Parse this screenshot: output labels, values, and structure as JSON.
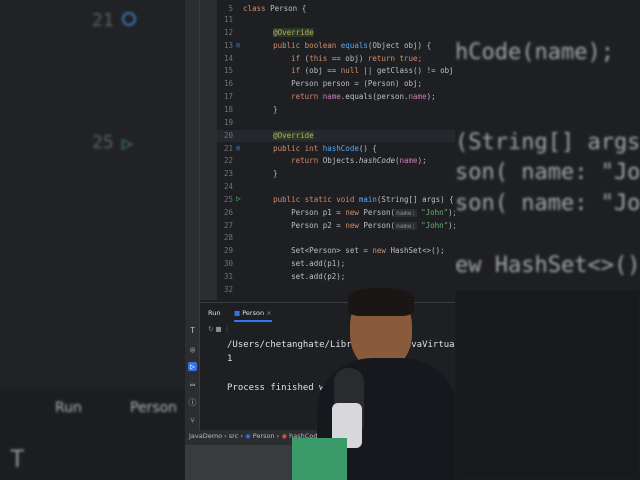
{
  "left_bg": {
    "line_numbers": [
      "21",
      "25"
    ],
    "run_label": "Run",
    "tab_label": "Person"
  },
  "right_bg": {
    "lines": [
      "hCode(name);",
      "(String[] args) {",
      "son( name: \"John\");",
      "son( name: \"John\");",
      "ew HashSet<>();"
    ]
  },
  "editor": {
    "sticky_header": {
      "num": "5",
      "text": "class Person {"
    },
    "current_line": "20",
    "lines": [
      {
        "n": "11",
        "t": []
      },
      {
        "n": "12",
        "t": [
          [
            "    ",
            ""
          ],
          [
            "@Override",
            "an"
          ]
        ]
      },
      {
        "n": "13",
        "t": [
          [
            "    ",
            ""
          ],
          [
            "public boolean ",
            "kw"
          ],
          [
            "equals",
            "fn"
          ],
          [
            "(Object obj) {",
            ""
          ]
        ]
      },
      {
        "n": "14",
        "t": [
          [
            "        ",
            ""
          ],
          [
            "if ",
            "kw"
          ],
          [
            "(",
            ""
          ],
          [
            "this",
            "kw"
          ],
          [
            " == obj) ",
            ""
          ],
          [
            "return true",
            "kw"
          ],
          [
            ";",
            "kw"
          ]
        ]
      },
      {
        "n": "15",
        "t": [
          [
            "        ",
            ""
          ],
          [
            "if ",
            "kw"
          ],
          [
            "(obj == ",
            ""
          ],
          [
            "null",
            "kw"
          ],
          [
            " || getClass() != obj.",
            ""
          ]
        ]
      },
      {
        "n": "16",
        "t": [
          [
            "        Person person = (Person) obj;",
            ""
          ]
        ]
      },
      {
        "n": "17",
        "t": [
          [
            "        ",
            ""
          ],
          [
            "return ",
            "kw"
          ],
          [
            "name",
            "fd"
          ],
          [
            ".equals(person.",
            ""
          ],
          [
            "name",
            "fd"
          ],
          [
            ");",
            ""
          ]
        ]
      },
      {
        "n": "18",
        "t": [
          [
            "    }",
            ""
          ]
        ]
      },
      {
        "n": "19",
        "t": []
      },
      {
        "n": "20",
        "t": [
          [
            "    ",
            ""
          ],
          [
            "@Override",
            "an"
          ]
        ]
      },
      {
        "n": "21",
        "t": [
          [
            "    ",
            ""
          ],
          [
            "public int ",
            "kw"
          ],
          [
            "hashCode",
            "fn"
          ],
          [
            "() {",
            ""
          ]
        ]
      },
      {
        "n": "22",
        "t": [
          [
            "        ",
            ""
          ],
          [
            "return ",
            "kw"
          ],
          [
            "Objects.",
            ""
          ],
          [
            "hashCode",
            "it"
          ],
          [
            "(",
            ""
          ],
          [
            "name",
            "fd"
          ],
          [
            ");",
            ""
          ]
        ]
      },
      {
        "n": "23",
        "t": [
          [
            "    }",
            ""
          ]
        ]
      },
      {
        "n": "24",
        "t": []
      },
      {
        "n": "25",
        "t": [
          [
            "    ",
            ""
          ],
          [
            "public static void ",
            "kw"
          ],
          [
            "main",
            "fn"
          ],
          [
            "(String[] args) {",
            ""
          ]
        ]
      },
      {
        "n": "26",
        "t": [
          [
            "        Person p1 = ",
            ""
          ],
          [
            "new ",
            "kw"
          ],
          [
            "Person(",
            ""
          ],
          [
            "name:",
            "hint"
          ],
          [
            " \"John\"",
            "st"
          ],
          [
            ");",
            ""
          ]
        ]
      },
      {
        "n": "27",
        "t": [
          [
            "        Person p2 = ",
            ""
          ],
          [
            "new ",
            "kw"
          ],
          [
            "Person(",
            ""
          ],
          [
            "name:",
            "hint"
          ],
          [
            " \"John\"",
            "st"
          ],
          [
            ");",
            ""
          ]
        ]
      },
      {
        "n": "28",
        "t": []
      },
      {
        "n": "29",
        "t": [
          [
            "        Set<Person> set = ",
            ""
          ],
          [
            "new ",
            "kw"
          ],
          [
            "HashSet<>();",
            ""
          ]
        ]
      },
      {
        "n": "30",
        "t": [
          [
            "        set.add(p1);",
            ""
          ]
        ]
      },
      {
        "n": "31",
        "t": [
          [
            "        set.add(p2);",
            ""
          ]
        ]
      },
      {
        "n": "32",
        "t": []
      }
    ]
  },
  "run_panel": {
    "title": "Run",
    "tab": "Person",
    "console": [
      "/Users/chetanghate/Library/Java/JavaVirtual",
      "1",
      "Process finished with"
    ]
  },
  "breadcrumb": [
    "JavaDemo",
    "src",
    "Person",
    "hashCode"
  ]
}
